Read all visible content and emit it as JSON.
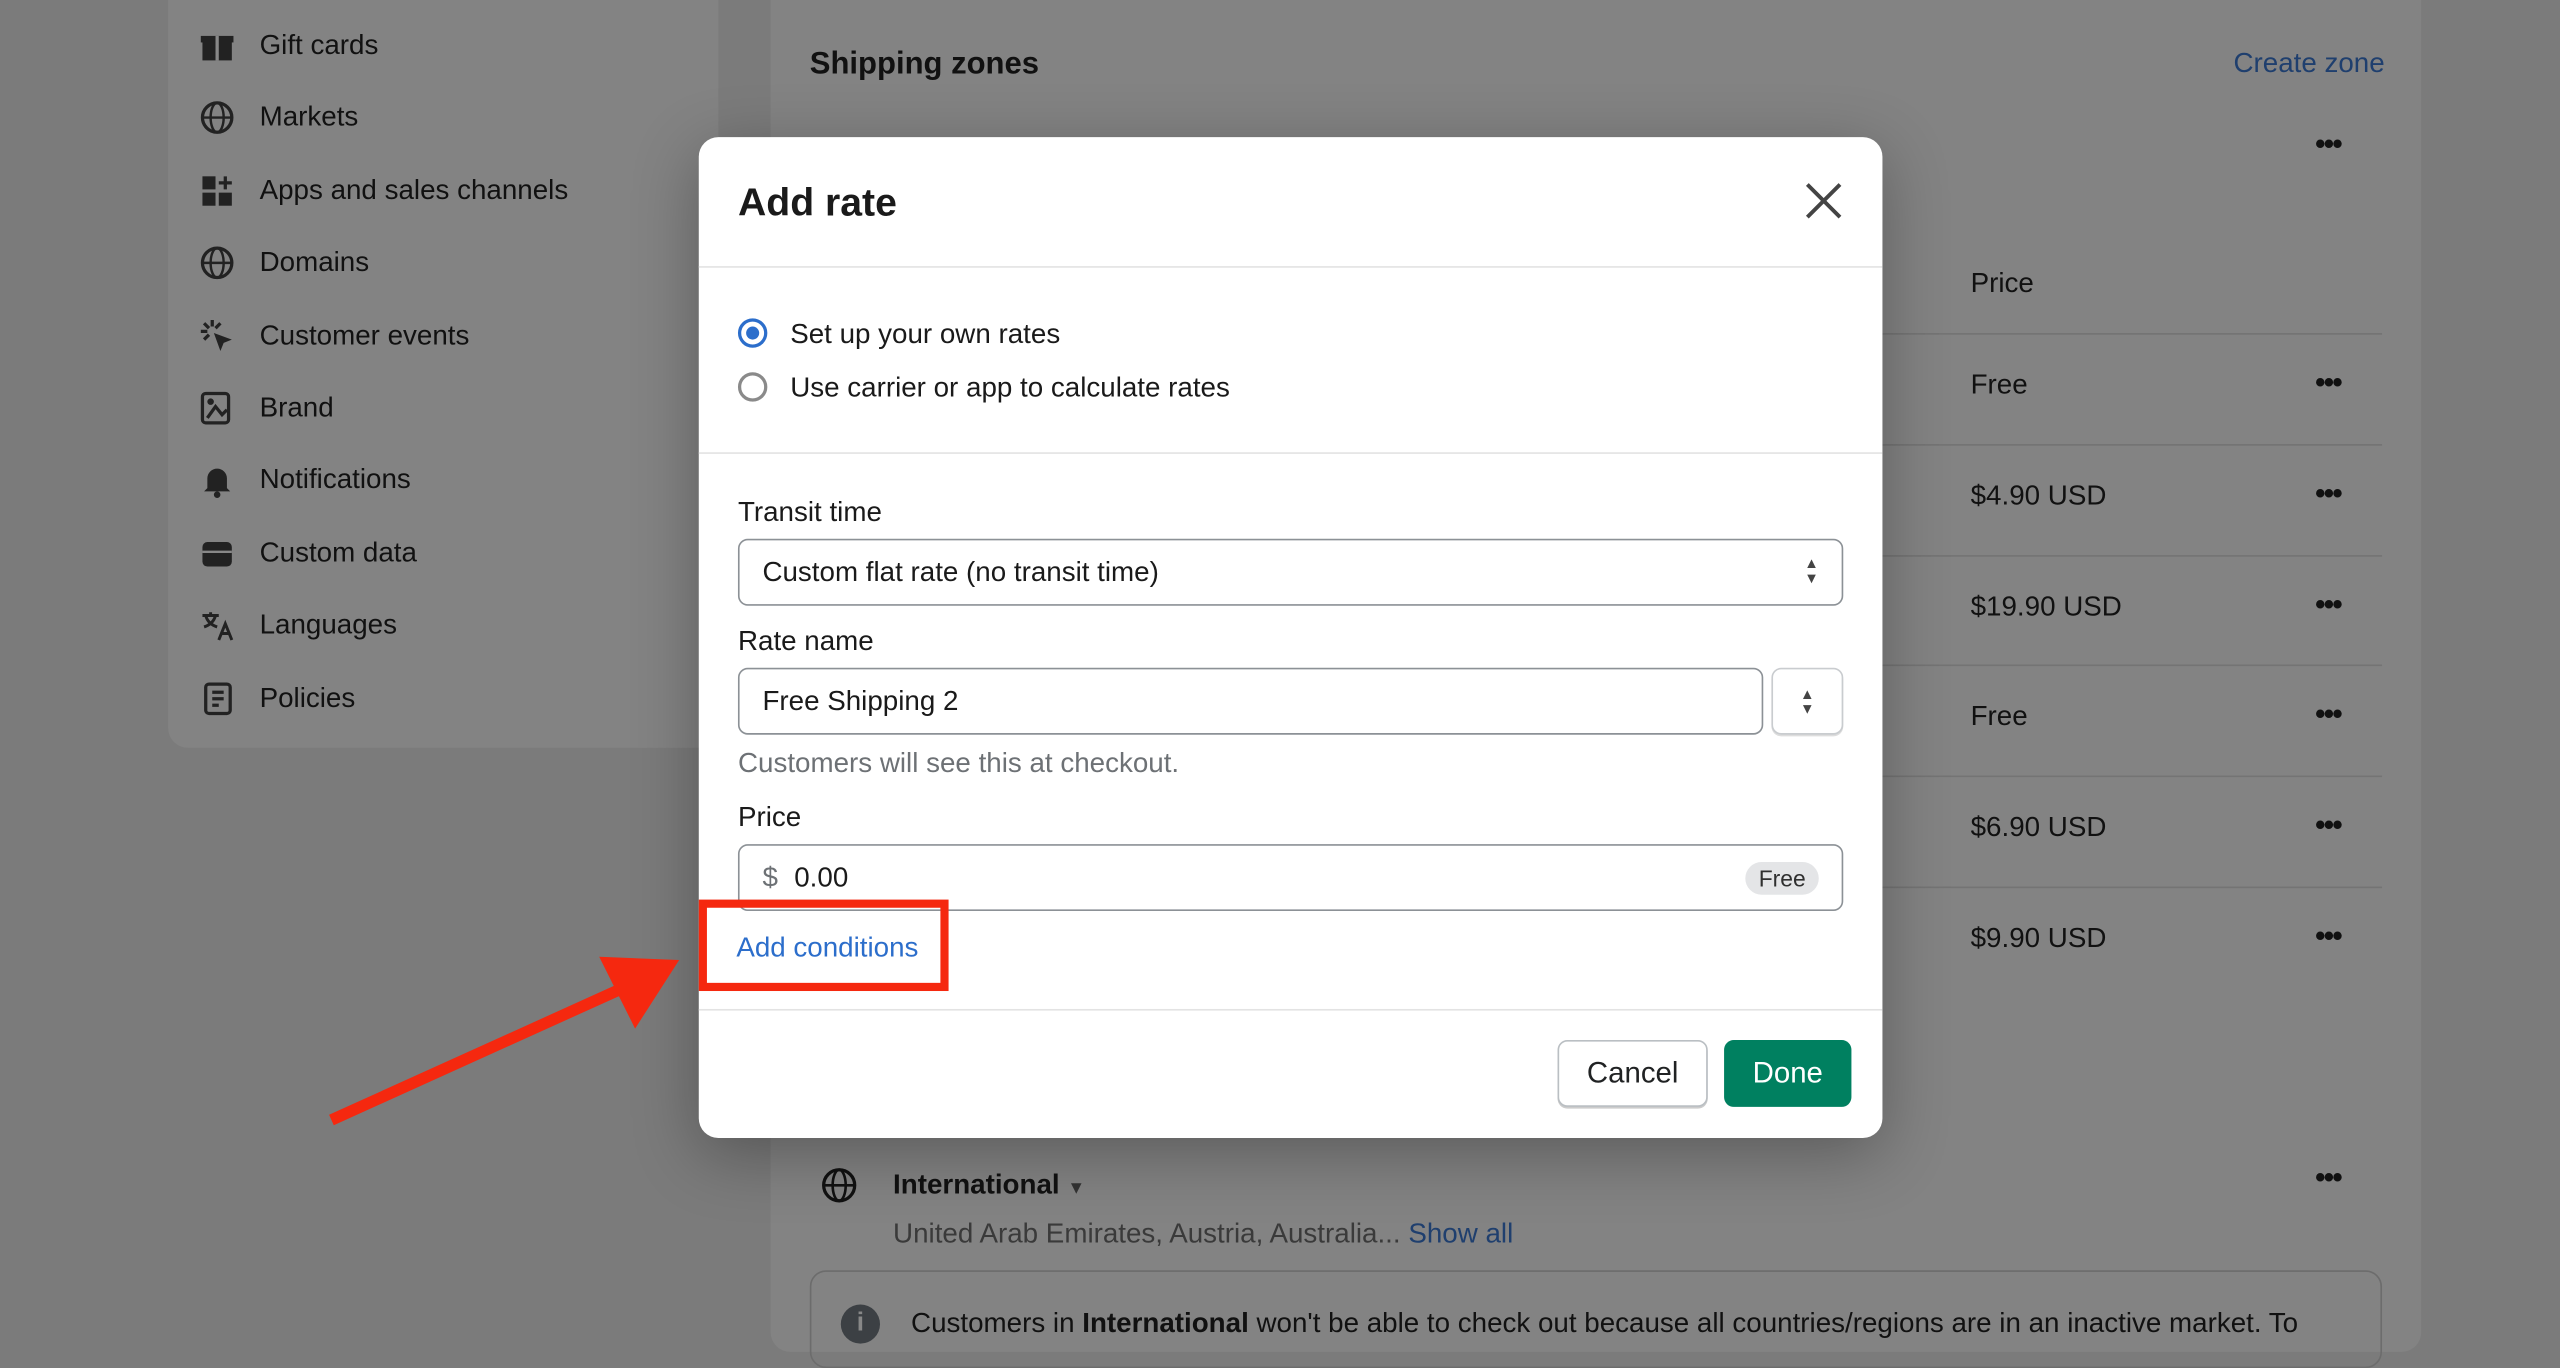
{
  "sidebar": {
    "items": [
      {
        "label": "Gift cards",
        "icon": "gift-icon"
      },
      {
        "label": "Markets",
        "icon": "globe-icon"
      },
      {
        "label": "Apps and sales channels",
        "icon": "apps-icon"
      },
      {
        "label": "Domains",
        "icon": "globe-icon"
      },
      {
        "label": "Customer events",
        "icon": "cursor-click-icon"
      },
      {
        "label": "Brand",
        "icon": "brand-icon"
      },
      {
        "label": "Notifications",
        "icon": "bell-icon"
      },
      {
        "label": "Custom data",
        "icon": "database-icon"
      },
      {
        "label": "Languages",
        "icon": "translate-icon"
      },
      {
        "label": "Policies",
        "icon": "document-icon"
      }
    ]
  },
  "shipping": {
    "title": "Shipping zones",
    "create_zone": "Create zone",
    "price_header": "Price",
    "prices": [
      "Free",
      "$4.90 USD",
      "$19.90 USD",
      "Free",
      "$6.90 USD",
      "$9.90 USD"
    ],
    "more": "•••",
    "international": {
      "name": "International",
      "countries": "United Arab Emirates, Austria, Australia...",
      "show_all": "Show all"
    },
    "banner": {
      "prefix": "Customers in ",
      "bold": "International",
      "suffix": " won't be able to check out because all countries/regions are in an inactive market. To"
    }
  },
  "modal": {
    "title": "Add rate",
    "radios": [
      {
        "label": "Set up your own rates",
        "checked": true
      },
      {
        "label": "Use carrier or app to calculate rates",
        "checked": false
      }
    ],
    "transit_label": "Transit time",
    "transit_value": "Custom flat rate (no transit time)",
    "rate_name_label": "Rate name",
    "rate_name_value": "Free Shipping 2",
    "help_text": "Customers will see this at checkout.",
    "price_label": "Price",
    "currency": "$",
    "price_value": "0.00",
    "free_badge": "Free",
    "add_conditions": "Add conditions",
    "cancel": "Cancel",
    "done": "Done"
  },
  "colors": {
    "accent": "#2c6ecb",
    "primary": "#008060",
    "annotation": "#f5280f"
  }
}
